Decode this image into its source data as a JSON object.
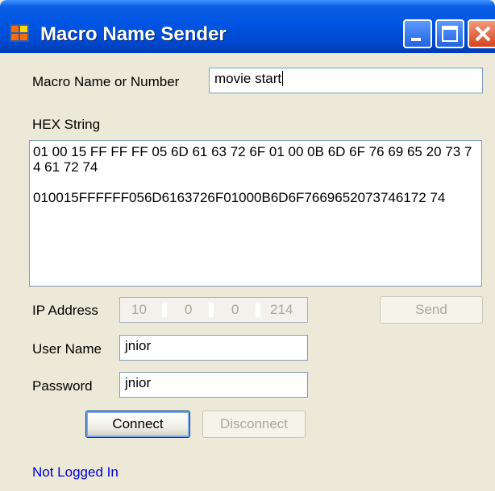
{
  "window": {
    "title": "Macro Name Sender",
    "controls": {
      "minimize": "minimize",
      "maximize": "maximize",
      "close": "close"
    }
  },
  "macro": {
    "label": "Macro Name or Number",
    "value": "movie start"
  },
  "hex": {
    "label": "HEX String",
    "spaced": "01 00 15 FF FF FF 05 6D 61 63 72 6F 01 00 0B 6D 6F 76 69 65 20 73 74 61 72 74",
    "compact": "010015FFFFFF056D6163726F01000B6D6F7669652073746172 74"
  },
  "ip": {
    "label": "IP Address",
    "octets": [
      "10",
      "0",
      "0",
      "214"
    ]
  },
  "user": {
    "label": "User Name",
    "value": "jnior"
  },
  "password": {
    "label": "Password",
    "value": "jnior"
  },
  "buttons": {
    "send": "Send",
    "connect": "Connect",
    "disconnect": "Disconnect"
  },
  "status": {
    "text": "Not Logged In",
    "color": "#0000cc"
  },
  "icons": [
    "app-icon",
    "minimize-icon",
    "maximize-icon",
    "close-icon"
  ]
}
